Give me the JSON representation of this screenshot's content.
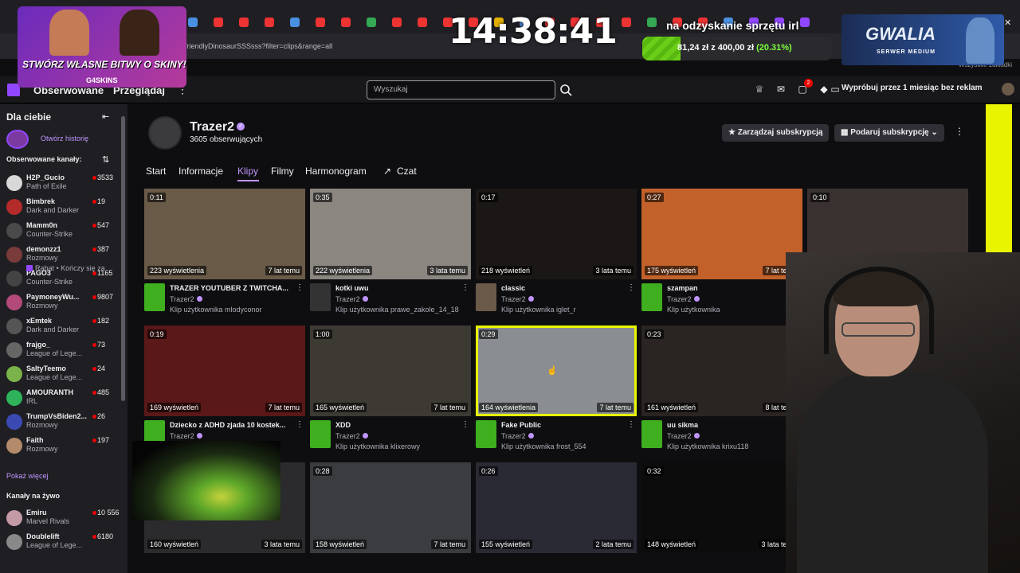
{
  "browser": {
    "url": "friendlyDinosaurSSSsss?filter=clips&range=all",
    "bookmarks": "Wszystkie zakładki",
    "tab_colors": [
      "#4a90e2",
      "#e33",
      "#e33",
      "#e33",
      "#4a90e2",
      "#e33",
      "#e33",
      "#34a853",
      "#e33",
      "#e33",
      "#e33",
      "#e33",
      "#e3b000",
      "#4a90e2",
      "#e33",
      "#e33",
      "#e33",
      "#e33",
      "#34a853",
      "#e33",
      "#e33",
      "#4a90e2",
      "#9147ff",
      "#9147ff",
      "#9147ff"
    ]
  },
  "nav": {
    "following": "Obserwowane",
    "browse": "Przeglądaj",
    "more": "⋮",
    "search_placeholder": "Wyszukaj",
    "notif_count": "2",
    "promo": "Wypróbuj przez 1 miesiąc bez reklam"
  },
  "sidebar": {
    "title": "Dla ciebie",
    "history": "Otwórz historię",
    "followed_header": "Obserwowane kanały:",
    "channels": [
      {
        "name": "H2P_Gucio",
        "game": "Path of Exile",
        "count": "3533",
        "color": "#d8d8d8"
      },
      {
        "name": "Bimbrek",
        "game": "Dark and Darker",
        "count": "19",
        "color": "#b32b2b"
      },
      {
        "name": "Mamm0n",
        "game": "Counter-Strike",
        "count": "547",
        "color": "#4a4a4a"
      },
      {
        "name": "demonzz1",
        "game": "Rozmowy",
        "count": "387",
        "color": "#7a3b3b"
      },
      {
        "name": "PAGO3",
        "game": "Counter-Strike",
        "count": "1165",
        "color": "#444"
      },
      {
        "name": "PaymoneyWu...",
        "game": "Rozmowy",
        "count": "9807",
        "color": "#b34a7a"
      },
      {
        "name": "xEmtek",
        "game": "Dark and Darker",
        "count": "182",
        "color": "#555"
      },
      {
        "name": "frajgo_",
        "game": "League of Lege...",
        "count": "73",
        "color": "#666"
      },
      {
        "name": "SaltyTeemo",
        "game": "League of Lege...",
        "count": "24",
        "color": "#7ab34a"
      },
      {
        "name": "AMOURANTH",
        "game": "IRL",
        "count": "485",
        "color": "#2eb35a"
      },
      {
        "name": "TrumpVsBiden2...",
        "game": "Rozmowy",
        "count": "26",
        "color": "#3b4ab3"
      },
      {
        "name": "Faith",
        "game": "Rozmowy",
        "count": "197",
        "color": "#b38a6a"
      }
    ],
    "demonzz1_extra": "Rabat • Kończy się za",
    "show_more": "Pokaż więcej",
    "live_header": "Kanały na żywo",
    "live": [
      {
        "name": "Emiru",
        "game": "Marvel Rivals",
        "count": "10 556",
        "color": "#c49aa6"
      },
      {
        "name": "Doublelift",
        "game": "League of Lege...",
        "count": "6180",
        "color": "#888"
      }
    ]
  },
  "channel": {
    "name": "Trazer2",
    "followers": "3605 obserwujących",
    "manage_sub": "Zarządzaj subskrypcją",
    "gift_sub": "Podaruj subskrypcję",
    "tabs": [
      "Start",
      "Informacje",
      "Klipy",
      "Filmy",
      "Harmonogram",
      "Czat"
    ],
    "active_tab": "Klipy"
  },
  "clips": [
    {
      "duration": "0:11",
      "views": "223 wyświetlenia",
      "age": "7 lat temu",
      "title": "TRAZER YOUTUBER Z TWITCHA...",
      "channel": "Trazer2",
      "by": "Klip użytkownika mlodyconor",
      "thumb": "#6a5a48",
      "av": "#3fae1f"
    },
    {
      "duration": "0:35",
      "views": "222 wyświetlenia",
      "age": "3 lata temu",
      "title": "kotki uwu",
      "channel": "Trazer2",
      "by": "Klip użytkownika prawe_zakole_14_18",
      "thumb": "#8b8680",
      "av": "#333"
    },
    {
      "duration": "0:17",
      "views": "218 wyświetleń",
      "age": "3 lata temu",
      "title": "classic",
      "channel": "Trazer2",
      "by": "Klip użytkownika iglet_r",
      "thumb": "#1a1716",
      "av": "#6b5a4a"
    },
    {
      "duration": "0:27",
      "views": "175 wyświetleń",
      "age": "7 lat temu",
      "title": "szampan",
      "channel": "Trazer2",
      "by": "Klip użytkownika",
      "thumb": "#c2612a",
      "av": "#3fae1f"
    },
    {
      "duration": "0:10",
      "views": "",
      "age": "",
      "title": "",
      "channel": "",
      "by": "",
      "thumb": "#3a3230",
      "av": ""
    },
    {
      "duration": "0:19",
      "views": "169 wyświetleń",
      "age": "7 lat temu",
      "title": "Dziecko z ADHD zjada 10 kostek...",
      "channel": "Trazer2",
      "by": "",
      "thumb": "#5a1818",
      "av": "#3fae1f"
    },
    {
      "duration": "1:00",
      "views": "165 wyświetleń",
      "age": "7 lat temu",
      "title": "XDD",
      "channel": "Trazer2",
      "by": "Klip użytkownika klixerowy",
      "thumb": "#3d3a34",
      "av": "#3fae1f"
    },
    {
      "duration": "0:29",
      "views": "164 wyświetlenia",
      "age": "7 lat temu",
      "title": "Fake Public",
      "channel": "Trazer2",
      "by": "Klip użytkownika frost_554",
      "thumb": "#8a8e92",
      "av": "#3fae1f"
    },
    {
      "duration": "0:23",
      "views": "161 wyświetleń",
      "age": "8 lat temu",
      "title": "uu sikma",
      "channel": "Trazer2",
      "by": "Klip użytkownika krixu118",
      "thumb": "#2a2522",
      "av": "#3fae1f"
    },
    {
      "duration": "",
      "views": "160 wyświetleń",
      "age": "3 lata temu",
      "title": "",
      "channel": "",
      "by": "",
      "thumb": "#2b2b2e",
      "av": ""
    },
    {
      "duration": "0:28",
      "views": "158 wyświetleń",
      "age": "7 lat temu",
      "title": "",
      "channel": "",
      "by": "",
      "thumb": "#3a3c40",
      "av": ""
    },
    {
      "duration": "0:26",
      "views": "155 wyświetleń",
      "age": "2 lata temu",
      "title": "",
      "channel": "",
      "by": "",
      "thumb": "#2a2a35",
      "av": ""
    },
    {
      "duration": "0:32",
      "views": "148 wyświetleń",
      "age": "3 lata temu",
      "title": "",
      "channel": "",
      "by": "",
      "thumb": "#0c0c0c",
      "av": ""
    }
  ],
  "overlay": {
    "skins_text": "STWÓRZ WŁASNE BITWY O SKINY!",
    "skins_logo": "G4SKINS",
    "clock": "14:38:41",
    "goal_title": "na odzyskanie sprzętu irl",
    "goal_text": "81,24 zł z 400,00 zł",
    "goal_pct": "(20.31%)",
    "goal_fraction": 0.2031,
    "gwalia_title": "GWALIA",
    "gwalia_sub": "SERWER MEDIUM"
  },
  "colors": {
    "accent": "#bf94ff",
    "twitch_purple": "#9147ff",
    "live_red": "#eb0400",
    "highlight": "#e8f400"
  }
}
